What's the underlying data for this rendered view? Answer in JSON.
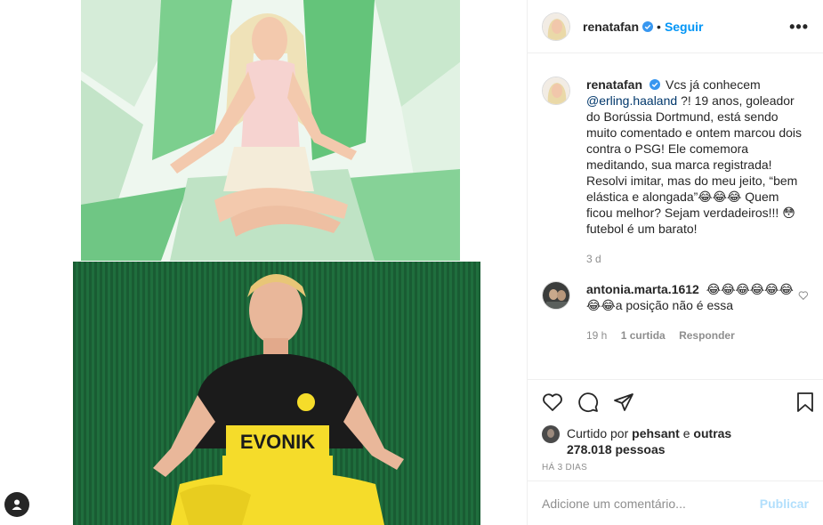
{
  "header": {
    "username": "renatafan",
    "separator": "•",
    "follow_label": "Seguir",
    "more_label": "•••"
  },
  "caption": {
    "username": "renatafan",
    "before_mention": "Vcs já conhecem",
    "mention": "@erling.haaland",
    "text": "?! 19 anos, goleador do Borússia Dortmund, está sendo muito comentado e ontem marcou dois contra o PSG! Ele comemora meditando, sua marca registrada! Resolvi imitar, mas do meu jeito, “bem elástica e alongada”😂😂😂 Quem ficou melhor? Sejam verdadeiros!!! 😳 futebol é um barato!",
    "age": "3 d"
  },
  "comment": {
    "username": "antonia.marta.1612",
    "text": "😂😂😂😂😂😂😂😂a posição não é essa",
    "age": "19 h",
    "likes": "1 curtida",
    "reply_label": "Responder"
  },
  "likes": {
    "prefix": "Curtido por",
    "user": "pehsant",
    "conjunction": "e",
    "others": "outras 278.018 pessoas"
  },
  "timestamp": "HÁ 3 DIAS",
  "add_comment": {
    "placeholder": "Adicione um comentário...",
    "publish_label": "Publicar"
  },
  "media": {
    "jersey_sponsor": "EVONIK"
  },
  "colors": {
    "accent": "#0095f6",
    "publish_disabled": "#b2dffc",
    "muted": "#8e8e8e",
    "mention": "#00376b"
  },
  "icons": [
    "verified-icon",
    "more-icon",
    "heart-icon",
    "comment-icon",
    "share-icon",
    "bookmark-icon",
    "user-tag-icon"
  ]
}
